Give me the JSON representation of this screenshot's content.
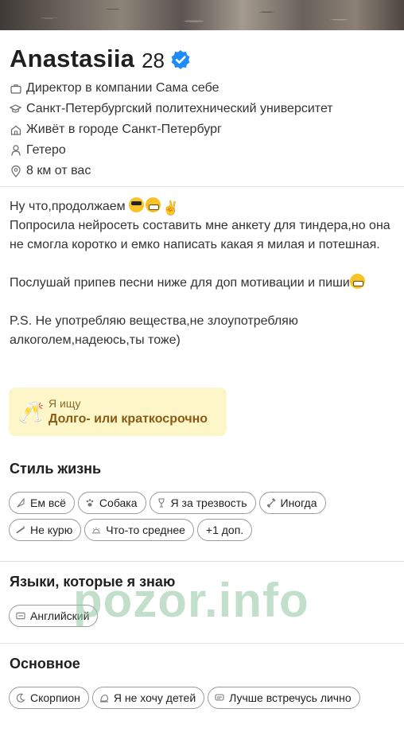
{
  "profile": {
    "name": "Anastasiia",
    "age": "28",
    "verified_icon": "verified-badge-icon",
    "info": [
      {
        "icon": "briefcase-icon",
        "text": "Директор в компании Сама себе"
      },
      {
        "icon": "graduation-cap-icon",
        "text": "Санкт-Петербургский политехнический университет"
      },
      {
        "icon": "home-icon",
        "text": "Живёт в городе Санкт-Петербург"
      },
      {
        "icon": "person-icon",
        "text": "Гетеро"
      },
      {
        "icon": "location-pin-icon",
        "text": "8 км от вас"
      }
    ]
  },
  "bio": {
    "line1": "Ну что,продолжаем",
    "line2": "Попросила нейросеть составить мне анкету для тиндера,но она не смогла коротко и емко написать какая я милая и потешная.",
    "line3": "Послушай припев песни ниже для доп мотивации и пиши",
    "line4": "P.S. Не употребляю вещества,не злоупотребляю алкоголем,надеюсь,ты тоже)"
  },
  "looking_for": {
    "icon": "champagne-glasses-icon",
    "label": "Я ищу",
    "value": "Долго- или краткосрочно"
  },
  "lifestyle": {
    "title": "Стиль жизнь",
    "chips": [
      {
        "icon": "food-icon",
        "label": "Ем всё"
      },
      {
        "icon": "paw-icon",
        "label": "Собака"
      },
      {
        "icon": "glass-icon",
        "label": "Я за трезвость"
      },
      {
        "icon": "dumbbell-icon",
        "label": "Иногда"
      },
      {
        "icon": "no-smoking-icon",
        "label": "Не курю"
      },
      {
        "icon": "sunset-icon",
        "label": "Что-то среднее"
      },
      {
        "icon": "",
        "label": "+1 доп."
      }
    ]
  },
  "languages": {
    "title": "Языки, которые я знаю",
    "chips": [
      {
        "icon": "language-icon",
        "label": "Английский"
      }
    ]
  },
  "basics": {
    "title": "Основное",
    "chips": [
      {
        "icon": "moon-icon",
        "label": "Скорпион"
      },
      {
        "icon": "baby-icon",
        "label": "Я не хочу детей"
      },
      {
        "icon": "chat-icon",
        "label": "Лучше встречусь лично"
      }
    ]
  },
  "watermark": "pozor.info",
  "colors": {
    "verified": "#1d8cf8",
    "looking_bg": "#fdf6c8",
    "looking_value": "#8a5a12",
    "watermark": "#8fc4a0"
  }
}
